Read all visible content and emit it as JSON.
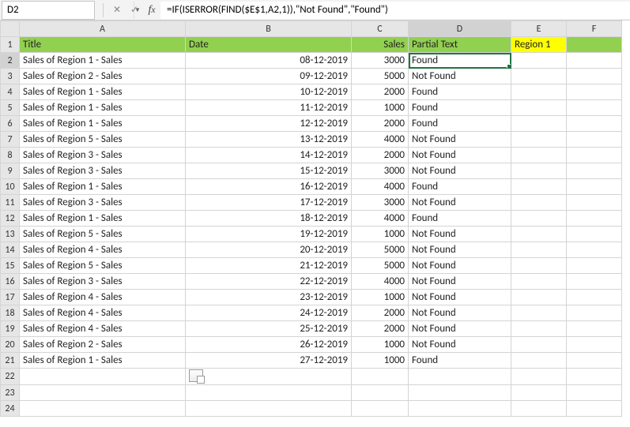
{
  "namebox": {
    "value": "D2"
  },
  "formula_bar": {
    "value": "=IF(ISERROR(FIND($E$1,A2,1)),\"Not Found\",\"Found\")"
  },
  "columns": [
    "A",
    "B",
    "C",
    "D",
    "E",
    "F"
  ],
  "active_col": "D",
  "active_row": 2,
  "header_row": {
    "title": "Title",
    "date": "Date",
    "sales": "Sales",
    "partial": "Partial Text",
    "lookup": "Region 1"
  },
  "rows": [
    {
      "r": 2,
      "title": "Sales of Region 1 - Sales",
      "date": "08-12-2019",
      "sales": 3000,
      "partial": "Found"
    },
    {
      "r": 3,
      "title": "Sales of Region 2 - Sales",
      "date": "09-12-2019",
      "sales": 5000,
      "partial": "Not Found"
    },
    {
      "r": 4,
      "title": "Sales of Region 1 - Sales",
      "date": "10-12-2019",
      "sales": 2000,
      "partial": "Found"
    },
    {
      "r": 5,
      "title": "Sales of Region 1 - Sales",
      "date": "11-12-2019",
      "sales": 1000,
      "partial": "Found"
    },
    {
      "r": 6,
      "title": "Sales of Region 1 - Sales",
      "date": "12-12-2019",
      "sales": 2000,
      "partial": "Found"
    },
    {
      "r": 7,
      "title": "Sales of Region 5 - Sales",
      "date": "13-12-2019",
      "sales": 4000,
      "partial": "Not Found"
    },
    {
      "r": 8,
      "title": "Sales of Region 3 - Sales",
      "date": "14-12-2019",
      "sales": 2000,
      "partial": "Not Found"
    },
    {
      "r": 9,
      "title": "Sales of Region 3 - Sales",
      "date": "15-12-2019",
      "sales": 3000,
      "partial": "Not Found"
    },
    {
      "r": 10,
      "title": "Sales of Region 1 - Sales",
      "date": "16-12-2019",
      "sales": 4000,
      "partial": "Found"
    },
    {
      "r": 11,
      "title": "Sales of Region 3 - Sales",
      "date": "17-12-2019",
      "sales": 3000,
      "partial": "Not Found"
    },
    {
      "r": 12,
      "title": "Sales of Region 1 - Sales",
      "date": "18-12-2019",
      "sales": 4000,
      "partial": "Found"
    },
    {
      "r": 13,
      "title": "Sales of Region 5 - Sales",
      "date": "19-12-2019",
      "sales": 1000,
      "partial": "Not Found"
    },
    {
      "r": 14,
      "title": "Sales of Region 4 - Sales",
      "date": "20-12-2019",
      "sales": 5000,
      "partial": "Not Found"
    },
    {
      "r": 15,
      "title": "Sales of Region 5 - Sales",
      "date": "21-12-2019",
      "sales": 5000,
      "partial": "Not Found"
    },
    {
      "r": 16,
      "title": "Sales of Region 3 - Sales",
      "date": "22-12-2019",
      "sales": 4000,
      "partial": "Not Found"
    },
    {
      "r": 17,
      "title": "Sales of Region 4 - Sales",
      "date": "23-12-2019",
      "sales": 1000,
      "partial": "Not Found"
    },
    {
      "r": 18,
      "title": "Sales of Region 4 - Sales",
      "date": "24-12-2019",
      "sales": 2000,
      "partial": "Not Found"
    },
    {
      "r": 19,
      "title": "Sales of Region 4 - Sales",
      "date": "25-12-2019",
      "sales": 2000,
      "partial": "Not Found"
    },
    {
      "r": 20,
      "title": "Sales of Region 2 - Sales",
      "date": "26-12-2019",
      "sales": 1000,
      "partial": "Not Found"
    },
    {
      "r": 21,
      "title": "Sales of Region 1 - Sales",
      "date": "27-12-2019",
      "sales": 1000,
      "partial": "Found"
    }
  ],
  "blank_rows": [
    22,
    23,
    24
  ]
}
